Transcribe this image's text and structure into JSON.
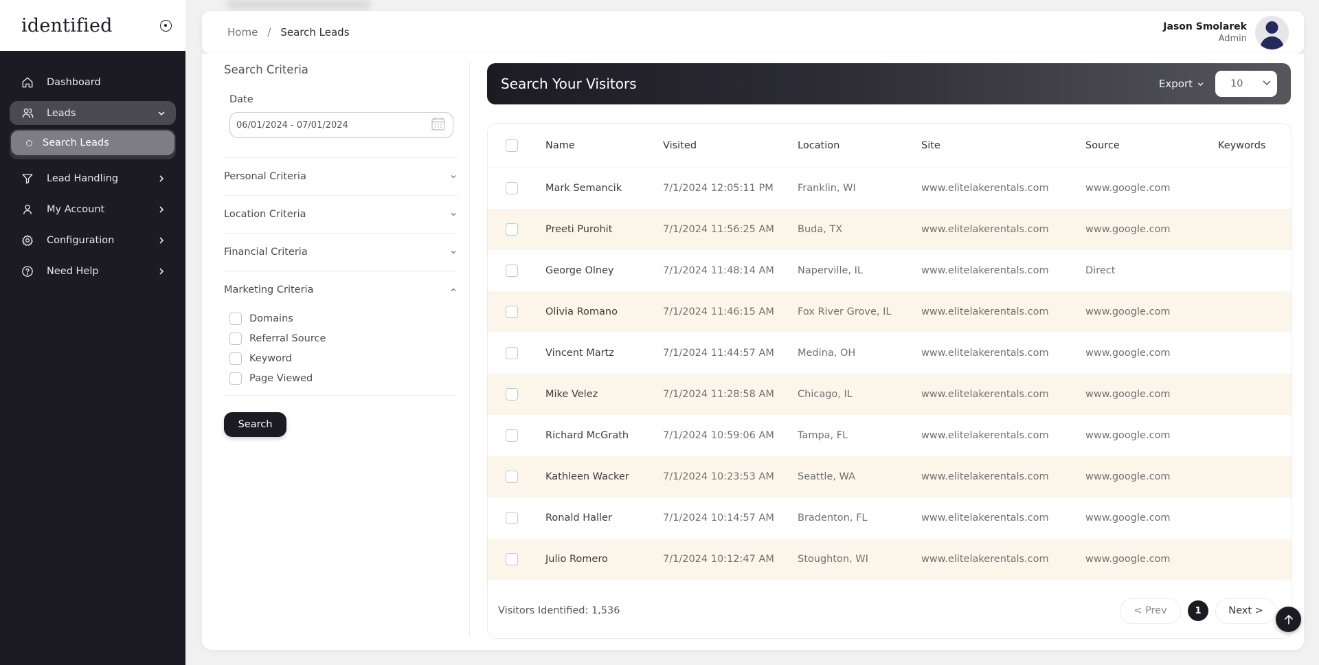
{
  "brand": {
    "logo": "identified",
    "toggle_icon": "circle-dot-icon"
  },
  "sidebar": {
    "items": [
      {
        "label": "Dashboard",
        "icon": "home-icon",
        "has_chevron": false
      },
      {
        "label": "Leads",
        "icon": "users-icon",
        "has_chevron": true,
        "expanded": true
      },
      {
        "label": "Lead Handling",
        "icon": "filter-icon",
        "has_chevron": true
      },
      {
        "label": "My Account",
        "icon": "user-icon",
        "has_chevron": true
      },
      {
        "label": "Configuration",
        "icon": "gear-icon",
        "has_chevron": true
      },
      {
        "label": "Need Help",
        "icon": "help-icon",
        "has_chevron": true
      }
    ],
    "sub_items": [
      {
        "label": "Search Leads",
        "active": true
      }
    ]
  },
  "breadcrumb": {
    "home": "Home",
    "separator": "/",
    "current": "Search Leads"
  },
  "user": {
    "name": "Jason Smolarek",
    "role": "Admin"
  },
  "criteria": {
    "title": "Search Criteria",
    "date_label": "Date",
    "date_value": "06/01/2024 - 07/01/2024",
    "sections": [
      {
        "label": "Personal Criteria",
        "expanded": false
      },
      {
        "label": "Location Criteria",
        "expanded": false
      },
      {
        "label": "Financial Criteria",
        "expanded": false
      },
      {
        "label": "Marketing Criteria",
        "expanded": true
      }
    ],
    "marketing_options": [
      {
        "label": "Domains",
        "checked": false
      },
      {
        "label": "Referral Source",
        "checked": false
      },
      {
        "label": "Keyword",
        "checked": false
      },
      {
        "label": "Page Viewed",
        "checked": false
      }
    ],
    "search_button": "Search"
  },
  "visitors": {
    "title": "Search Your Visitors",
    "export_label": "Export",
    "per_page": "10",
    "columns": [
      "Name",
      "Visited",
      "Location",
      "Site",
      "Source",
      "Keywords"
    ],
    "rows": [
      {
        "name": "Mark Semancik",
        "visited": "7/1/2024 12:05:11 PM",
        "location": "Franklin, WI",
        "site": "www.elitelakerentals.com",
        "source": "www.google.com",
        "keywords": ""
      },
      {
        "name": "Preeti Purohit",
        "visited": "7/1/2024 11:56:25 AM",
        "location": "Buda, TX",
        "site": "www.elitelakerentals.com",
        "source": "www.google.com",
        "keywords": ""
      },
      {
        "name": "George Olney",
        "visited": "7/1/2024 11:48:14 AM",
        "location": "Naperville, IL",
        "site": "www.elitelakerentals.com",
        "source": "Direct",
        "keywords": ""
      },
      {
        "name": "Olivia Romano",
        "visited": "7/1/2024 11:46:15 AM",
        "location": "Fox River Grove, IL",
        "site": "www.elitelakerentals.com",
        "source": "www.google.com",
        "keywords": ""
      },
      {
        "name": "Vincent Martz",
        "visited": "7/1/2024 11:44:57 AM",
        "location": "Medina, OH",
        "site": "www.elitelakerentals.com",
        "source": "www.google.com",
        "keywords": ""
      },
      {
        "name": "Mike Velez",
        "visited": "7/1/2024 11:28:58 AM",
        "location": "Chicago, IL",
        "site": "www.elitelakerentals.com",
        "source": "www.google.com",
        "keywords": ""
      },
      {
        "name": "Richard McGrath",
        "visited": "7/1/2024 10:59:06 AM",
        "location": "Tampa, FL",
        "site": "www.elitelakerentals.com",
        "source": "www.google.com",
        "keywords": ""
      },
      {
        "name": "Kathleen Wacker",
        "visited": "7/1/2024 10:23:53 AM",
        "location": "Seattle, WA",
        "site": "www.elitelakerentals.com",
        "source": "www.google.com",
        "keywords": ""
      },
      {
        "name": "Ronald Haller",
        "visited": "7/1/2024 10:14:57 AM",
        "location": "Bradenton, FL",
        "site": "www.elitelakerentals.com",
        "source": "www.google.com",
        "keywords": ""
      },
      {
        "name": "Julio Romero",
        "visited": "7/1/2024 10:12:47 AM",
        "location": "Stoughton, WI",
        "site": "www.elitelakerentals.com",
        "source": "www.google.com",
        "keywords": ""
      }
    ],
    "count_text": "Visitors Identified: 1,536",
    "pagination": {
      "prev": "< Prev",
      "current_page": "1",
      "next": "Next >"
    }
  },
  "colors": {
    "sidebar_bg": "#1c1b24",
    "accent_dark": "#1c1b24",
    "row_stripe": "#fcf6ea"
  }
}
